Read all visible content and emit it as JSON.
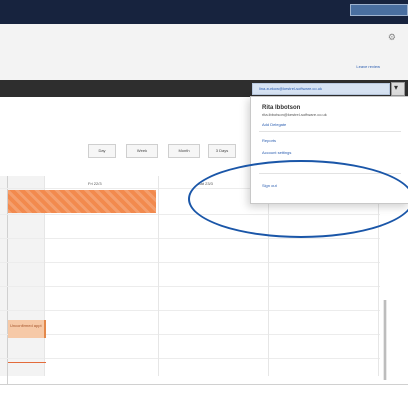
{
  "window": {
    "title": ""
  },
  "topbar": {
    "right_link": "Leave review"
  },
  "account": {
    "email_button": "lina.zurkow@kestrel-software.co.uk",
    "name": "Rita Ibbotson",
    "email": "rita.ibbotson@kestrel-software.co.uk",
    "menu": {
      "add_delegate": "Add Delegate",
      "reports": "Reports",
      "account_settings": "Account settings",
      "sign_out": "Sign out"
    }
  },
  "calendar": {
    "view_buttons": [
      "Day",
      "Week",
      "Month",
      "3 Days"
    ],
    "column_headers": [
      "Fri 22/3",
      "Sat 23/3"
    ],
    "event_partial_label": "Unconfirmed appt"
  },
  "annotation": {
    "color": "#1a56a8"
  }
}
